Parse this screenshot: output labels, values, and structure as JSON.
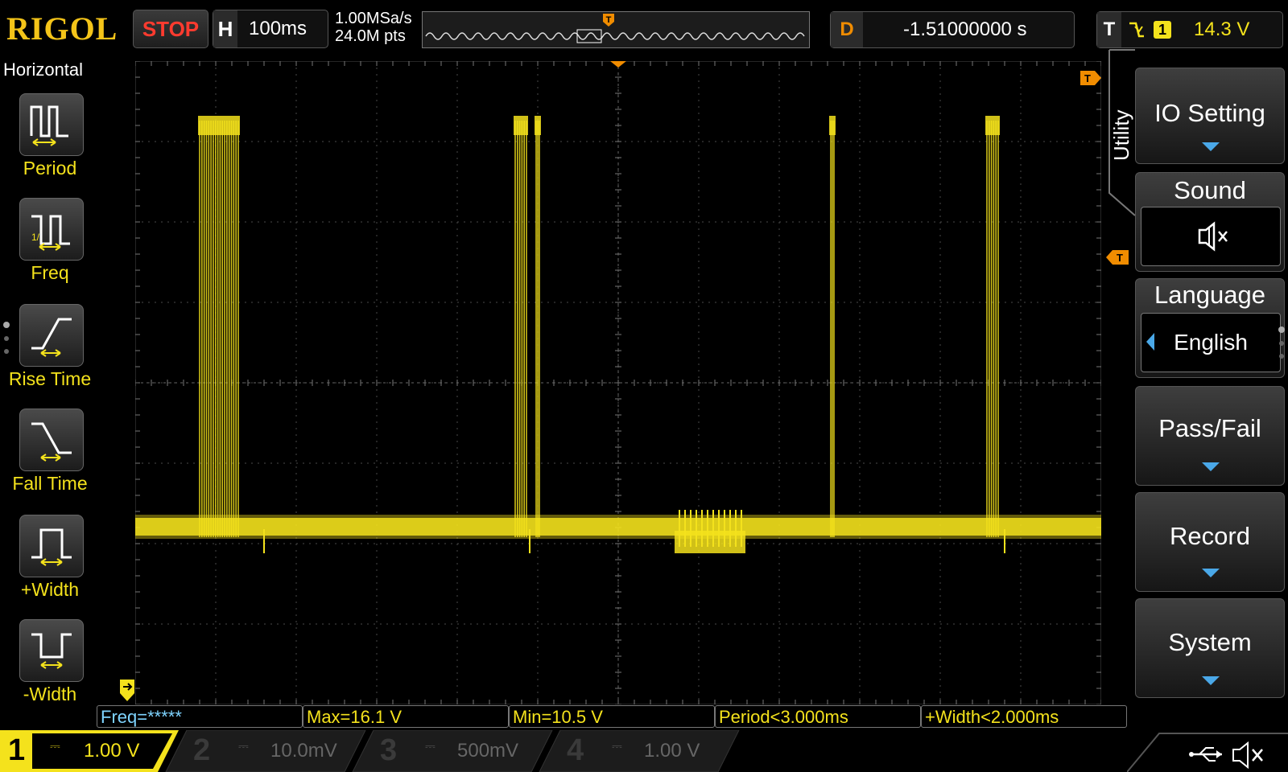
{
  "top_bar": {
    "brand": "RIGOL",
    "run_state": "STOP",
    "horizontal_label": "H",
    "timebase": "100ms",
    "sample_rate": "1.00MSa/s",
    "memory_depth": "24.0M pts",
    "delay_label": "D",
    "delay_value": "-1.51000000 s",
    "trigger_label": "T",
    "trigger_channel": "1",
    "trigger_level": "14.3 V"
  },
  "left_menu": {
    "title": "Horizontal",
    "items": [
      {
        "label": "Period",
        "icon": "period-icon"
      },
      {
        "label": "Freq",
        "icon": "frequency-icon"
      },
      {
        "label": "Rise Time",
        "icon": "rise-time-icon"
      },
      {
        "label": "Fall Time",
        "icon": "fall-time-icon"
      },
      {
        "label": "+Width",
        "icon": "positive-width-icon"
      },
      {
        "label": "-Width",
        "icon": "negative-width-icon"
      }
    ]
  },
  "right_menu": {
    "tab": "Utility",
    "items": [
      {
        "label": "IO Setting"
      },
      {
        "label": "Sound",
        "value_icon": "sound-muted-icon"
      },
      {
        "label": "Language",
        "value": "English"
      },
      {
        "label": "Pass/Fail"
      },
      {
        "label": "Record"
      },
      {
        "label": "System"
      }
    ]
  },
  "measurements": [
    "Freq=*****",
    "Max=16.1 V",
    "Min=10.5 V",
    "Period<3.000ms",
    "+Width<2.000ms"
  ],
  "channels": [
    {
      "num": "1",
      "scale": "1.00 V",
      "color": "#f4e21c",
      "active": true
    },
    {
      "num": "2",
      "scale": "10.0mV",
      "color": "#1e8fd6",
      "active": false
    },
    {
      "num": "3",
      "scale": "500mV",
      "color": "#c040c0",
      "active": false
    },
    {
      "num": "4",
      "scale": "1.00 V",
      "color": "#2f6fc0",
      "active": false
    }
  ],
  "colors": {
    "ch1": "#f4e21c",
    "brand": "#f4c419",
    "stop": "#ff3b2f",
    "trigger_marker": "#f08c00",
    "grid": "#4a4a4a"
  },
  "status_icons": [
    "usb-icon",
    "sound-muted-icon"
  ]
}
